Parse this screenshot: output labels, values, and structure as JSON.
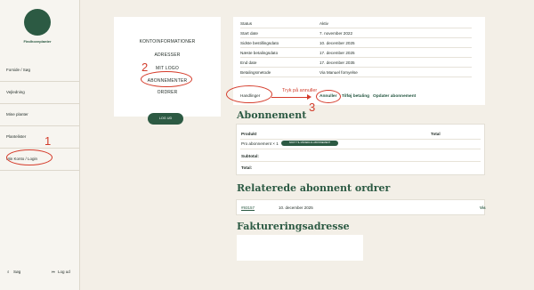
{
  "brand": {
    "name": "Findhoveplanter"
  },
  "sidebar": {
    "items": [
      "Forside / Søg",
      "Vejledning",
      "Mine planter",
      "Plantelister",
      "Min Konto / Login"
    ],
    "search": "Søg",
    "logout": "Log ud"
  },
  "account_menu": {
    "items": [
      "KONTOINFORMATIONER",
      "ADRESSER",
      "MIT LOGO",
      "ABONNEMENTER",
      "ORDRER"
    ],
    "logout_button": "LOG UD"
  },
  "subscription_info": [
    {
      "label": "Status",
      "value": "Aktiv"
    },
    {
      "label": "Start date",
      "value": "7. november 2022"
    },
    {
      "label": "Sidste bestillingsdato",
      "value": "10. december 2025"
    },
    {
      "label": "Næste betalingsdato",
      "value": "17. december 2025"
    },
    {
      "label": "End date",
      "value": "17. december 2035"
    },
    {
      "label": "Betalingsmetode",
      "value": "Via Manuel fornyelse"
    }
  ],
  "actions": {
    "label": "Handlinger",
    "cancel": "Annuller",
    "retry": "Tilføj betaling",
    "update": "Opdater abonnement"
  },
  "sections": {
    "subscription": "Abonnement",
    "related_orders": "Relaterede abonnent ordrer",
    "billing_address": "Faktureringsadresse"
  },
  "subscription_table": {
    "headers": [
      "Produkt",
      "Total"
    ],
    "product": "Pro abonnement × 1",
    "badge": "SKIFT TIL MÅNEDLIG ABONNEMENT",
    "subtotal": "Subtotal:",
    "total": "Total:"
  },
  "related_order": {
    "number": "#93157",
    "date": "10. december 2025",
    "view": "Vis"
  },
  "annotations": {
    "note": "Tryk på annuller",
    "numbers": [
      "1",
      "2",
      "3"
    ]
  }
}
